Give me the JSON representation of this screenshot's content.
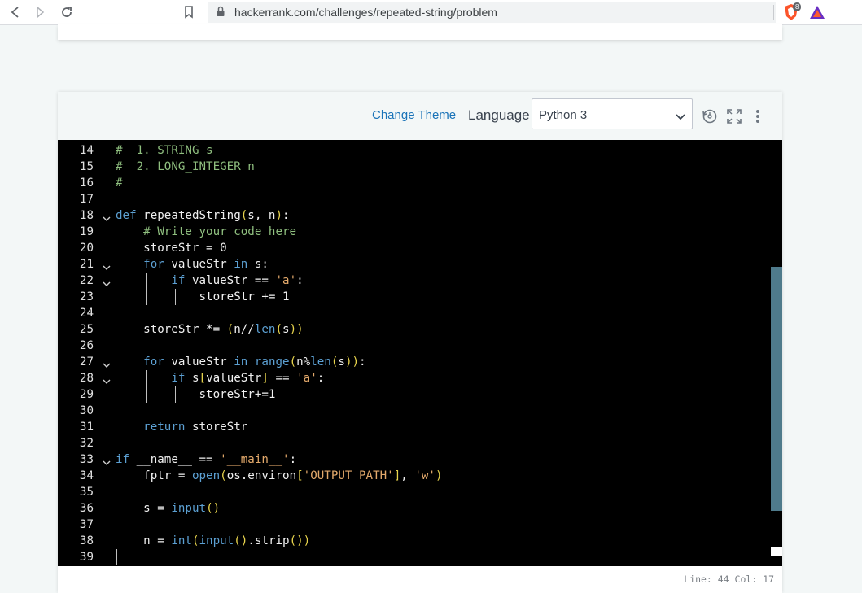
{
  "browser": {
    "url": "hackerrank.com/challenges/repeated-string/problem",
    "brave_badge": "8"
  },
  "editor": {
    "change_theme": "Change Theme",
    "language_label": "Language",
    "language_value": "Python 3",
    "status": "Line: 44 Col: 17"
  },
  "lines": [
    {
      "n": "14",
      "t": "#  1. STRING s"
    },
    {
      "n": "15",
      "t": "#  2. LONG_INTEGER n"
    },
    {
      "n": "16",
      "t": "#"
    },
    {
      "n": "17",
      "t": ""
    },
    {
      "n": "18",
      "t": "def repeatedString(s, n):"
    },
    {
      "n": "19",
      "t": "    # Write your code here"
    },
    {
      "n": "20",
      "t": "    storeStr = 0"
    },
    {
      "n": "21",
      "t": "    for valueStr in s:"
    },
    {
      "n": "22",
      "t": "        if valueStr == 'a':"
    },
    {
      "n": "23",
      "t": "            storeStr += 1"
    },
    {
      "n": "24",
      "t": ""
    },
    {
      "n": "25",
      "t": "    storeStr *= (n//len(s))"
    },
    {
      "n": "26",
      "t": ""
    },
    {
      "n": "27",
      "t": "    for valueStr in range(n%len(s)):"
    },
    {
      "n": "28",
      "t": "        if s[valueStr] == 'a':"
    },
    {
      "n": "29",
      "t": "            storeStr+=1"
    },
    {
      "n": "30",
      "t": ""
    },
    {
      "n": "31",
      "t": "    return storeStr"
    },
    {
      "n": "32",
      "t": ""
    },
    {
      "n": "33",
      "t": "if __name__ == '__main__':"
    },
    {
      "n": "34",
      "t": "    fptr = open(os.environ['OUTPUT_PATH'], 'w')"
    },
    {
      "n": "35",
      "t": ""
    },
    {
      "n": "36",
      "t": "    s = input()"
    },
    {
      "n": "37",
      "t": ""
    },
    {
      "n": "38",
      "t": "    n = int(input().strip())"
    },
    {
      "n": "39",
      "t": ""
    }
  ]
}
